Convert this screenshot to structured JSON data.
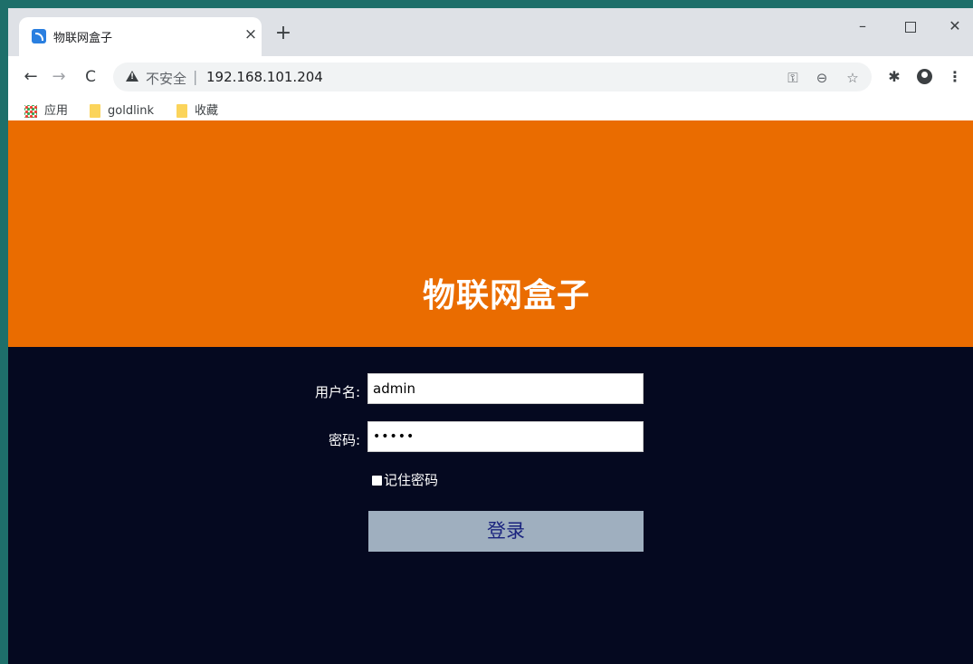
{
  "browser": {
    "tab": {
      "title": "物联网盒子",
      "close_label": "×"
    },
    "new_tab_label": "+",
    "window": {
      "minimize": "–",
      "close": "✕"
    },
    "toolbar": {
      "back": "←",
      "forward": "→",
      "reload": "C",
      "security_label": "不安全",
      "separator": "|",
      "url": "192.168.101.204",
      "menu": "⋮"
    },
    "bookmarks": [
      {
        "label": "应用",
        "icon": "apps-icon"
      },
      {
        "label": "goldlink",
        "icon": "folder-icon"
      },
      {
        "label": "收藏",
        "icon": "folder-icon"
      }
    ]
  },
  "page": {
    "banner_title": "物联网盒子",
    "banner_color": "#ea6c00",
    "background_color": "#050920",
    "username_label": "用户名:",
    "username_value": "admin",
    "password_label": "密码:",
    "password_value": "•••••",
    "remember_label": "记住密码",
    "login_button": "登录"
  }
}
